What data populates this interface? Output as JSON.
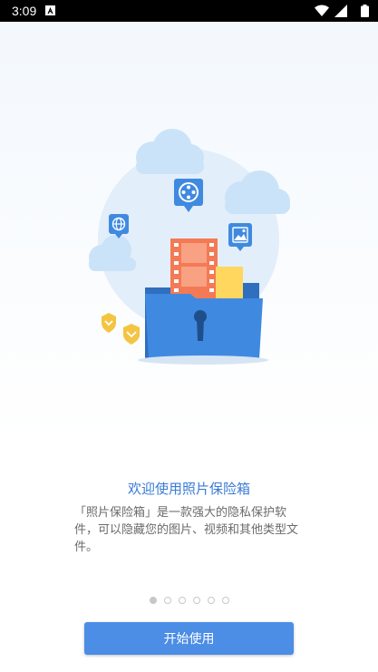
{
  "status_bar": {
    "time": "3:09",
    "app_icon": "a-icon",
    "icons": [
      "wifi-icon",
      "signal-icon",
      "battery-icon"
    ]
  },
  "illustration": {
    "icons": [
      "cloud-icon",
      "film-reel-icon",
      "globe-icon",
      "image-icon",
      "folder-icon",
      "lock-icon",
      "shield-icon"
    ],
    "colors": {
      "folder": "#3f8ae0",
      "filmstrip": "#f47a55",
      "note": "#ffd75e",
      "cloud": "#cfe5f9"
    }
  },
  "welcome": {
    "title": "欢迎使用照片保险箱",
    "description": "「照片保险箱」是一款强大的隐私保护软件，可以隐藏您的图片、视频和其他类型文件。"
  },
  "pagination": {
    "total": 6,
    "current": 1
  },
  "start_button": {
    "label": "开始使用",
    "color": "#4c8de6"
  }
}
